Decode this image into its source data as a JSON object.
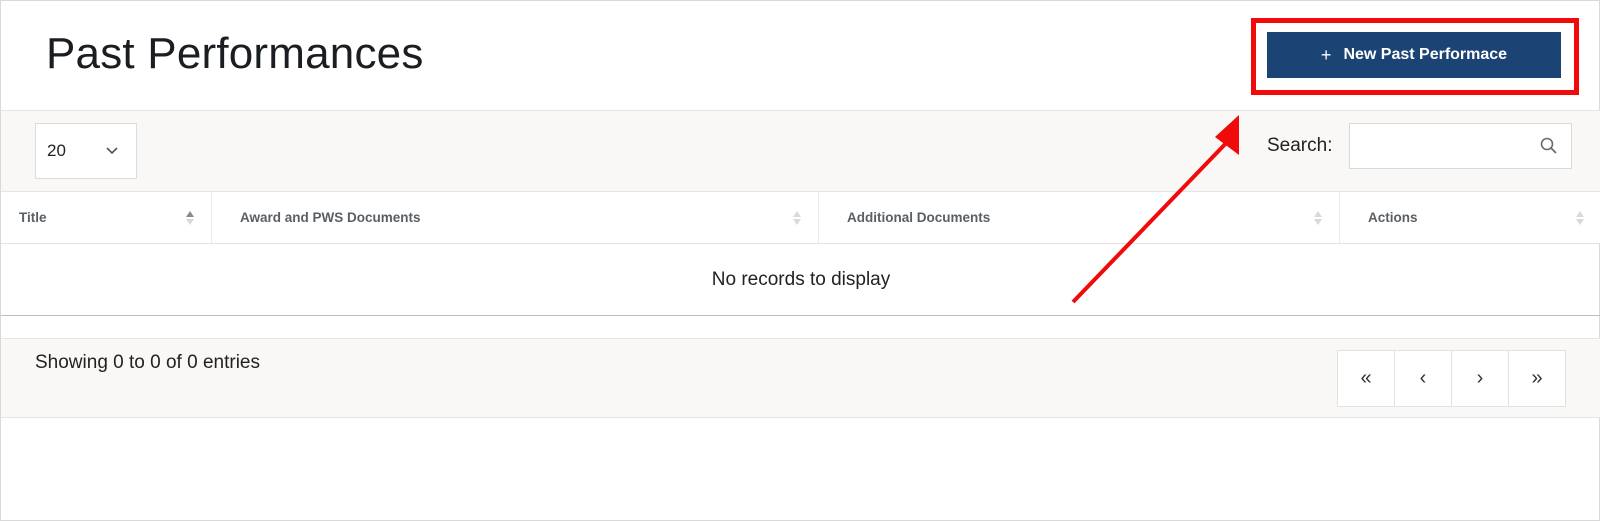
{
  "page": {
    "title": "Past Performances"
  },
  "header": {
    "new_button_label": "New Past Performace",
    "new_button_icon": "plus-icon"
  },
  "toolbar": {
    "page_size": "20",
    "search_label": "Search:",
    "search_value": ""
  },
  "table": {
    "columns": [
      "Title",
      "Award and PWS Documents",
      "Additional Documents",
      "Actions"
    ],
    "empty_text": "No records to display"
  },
  "footer": {
    "info": "Showing 0 to 0 of 0 entries",
    "pager": [
      "«",
      "‹",
      "›",
      "»"
    ]
  },
  "colors": {
    "primary_button": "#1b4474",
    "highlight": "#f00a0a",
    "toolbar_bg": "#f9f8f7"
  }
}
